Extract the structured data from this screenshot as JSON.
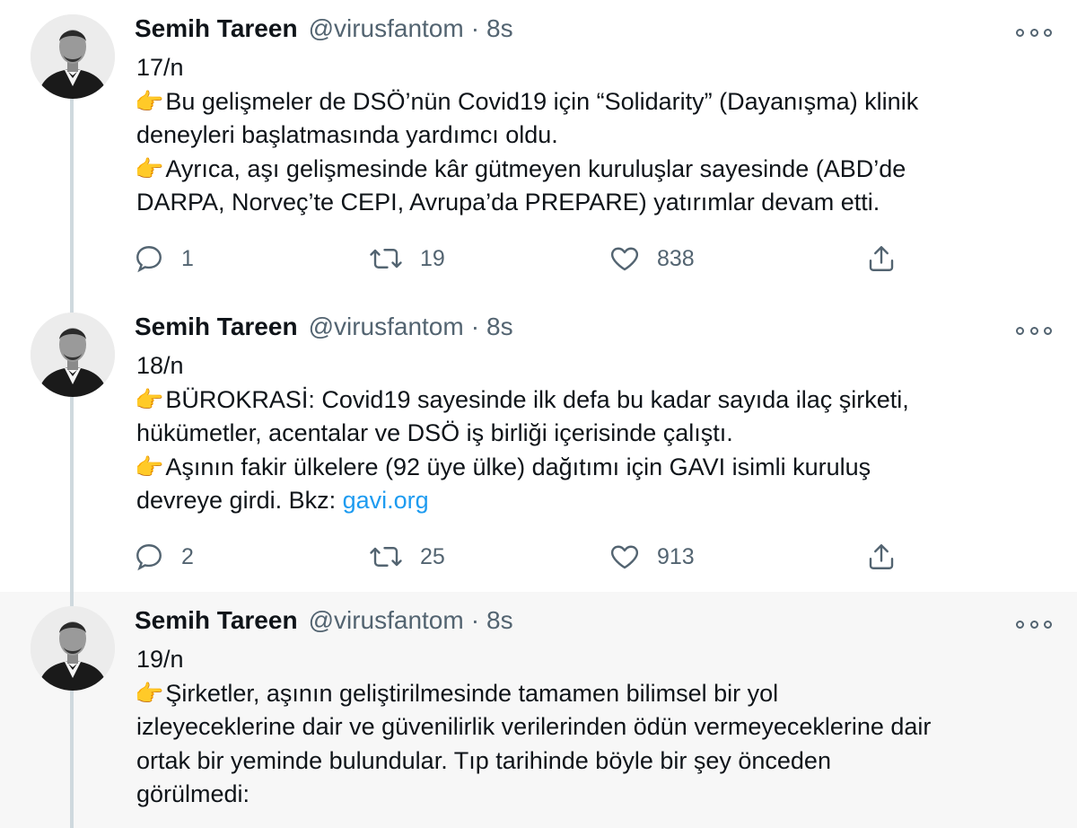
{
  "tweets": [
    {
      "name": "Semih Tareen",
      "handle": "@virusfantom",
      "separator": "·",
      "time": "8s",
      "lines": [
        {
          "hand": "",
          "text": "17/n"
        },
        {
          "hand": "👉",
          "text": "Bu gelişmeler de DSÖ’nün Covid19 için “Solidarity” (Dayanışma) klinik"
        },
        {
          "hand": "",
          "text": "deneyleri başlatmasında yardımcı oldu."
        },
        {
          "hand": "👉",
          "text": "Ayrıca, aşı gelişmesinde kâr gütmeyen kuruluşlar sayesinde (ABD’de"
        },
        {
          "hand": "",
          "text": "DARPA, Norveç’te CEPI, Avrupa’da PREPARE) yatırımlar devam etti."
        }
      ],
      "replies": "1",
      "retweets": "19",
      "likes": "838"
    },
    {
      "name": "Semih Tareen",
      "handle": "@virusfantom",
      "separator": "·",
      "time": "8s",
      "lines": [
        {
          "hand": "",
          "text": "18/n"
        },
        {
          "hand": "👉",
          "text": "BÜROKRASİ: Covid19 sayesinde ilk defa bu kadar sayıda ilaç şirketi,"
        },
        {
          "hand": "",
          "text": "hükümetler, acentalar ve DSÖ iş birliği içerisinde çalıştı."
        },
        {
          "hand": "👉",
          "text": "Aşının fakir ülkelere (92 üye ülke) dağıtımı için GAVI isimli kuruluş"
        },
        {
          "hand": "",
          "text": "devreye girdi. Bkz: ",
          "link": "gavi.org"
        }
      ],
      "replies": "2",
      "retweets": "25",
      "likes": "913"
    },
    {
      "name": "Semih Tareen",
      "handle": "@virusfantom",
      "separator": "·",
      "time": "8s",
      "lines": [
        {
          "hand": "",
          "text": "19/n"
        },
        {
          "hand": "👉",
          "text": "Şirketler, aşının geliştirilmesinde tamamen bilimsel bir yol"
        },
        {
          "hand": "",
          "text": "izleyeceklerine dair ve güvenilirlik verilerinden ödün vermeyeceklerine dair"
        },
        {
          "hand": "",
          "text": "ortak bir yeminde bulundular. Tıp tarihinde böyle bir şey önceden"
        },
        {
          "hand": "",
          "text": "görülmedi:"
        }
      ]
    }
  ],
  "icons": {
    "reply": "reply-icon",
    "retweet": "retweet-icon",
    "like": "heart-icon",
    "share": "share-icon",
    "more": "more-options-icon"
  },
  "colors": {
    "text": "#0f1419",
    "secondary": "#536471",
    "link": "#1d9bf0",
    "thread_line": "#cfd9de",
    "highlight_bg": "#f7f7f7"
  }
}
